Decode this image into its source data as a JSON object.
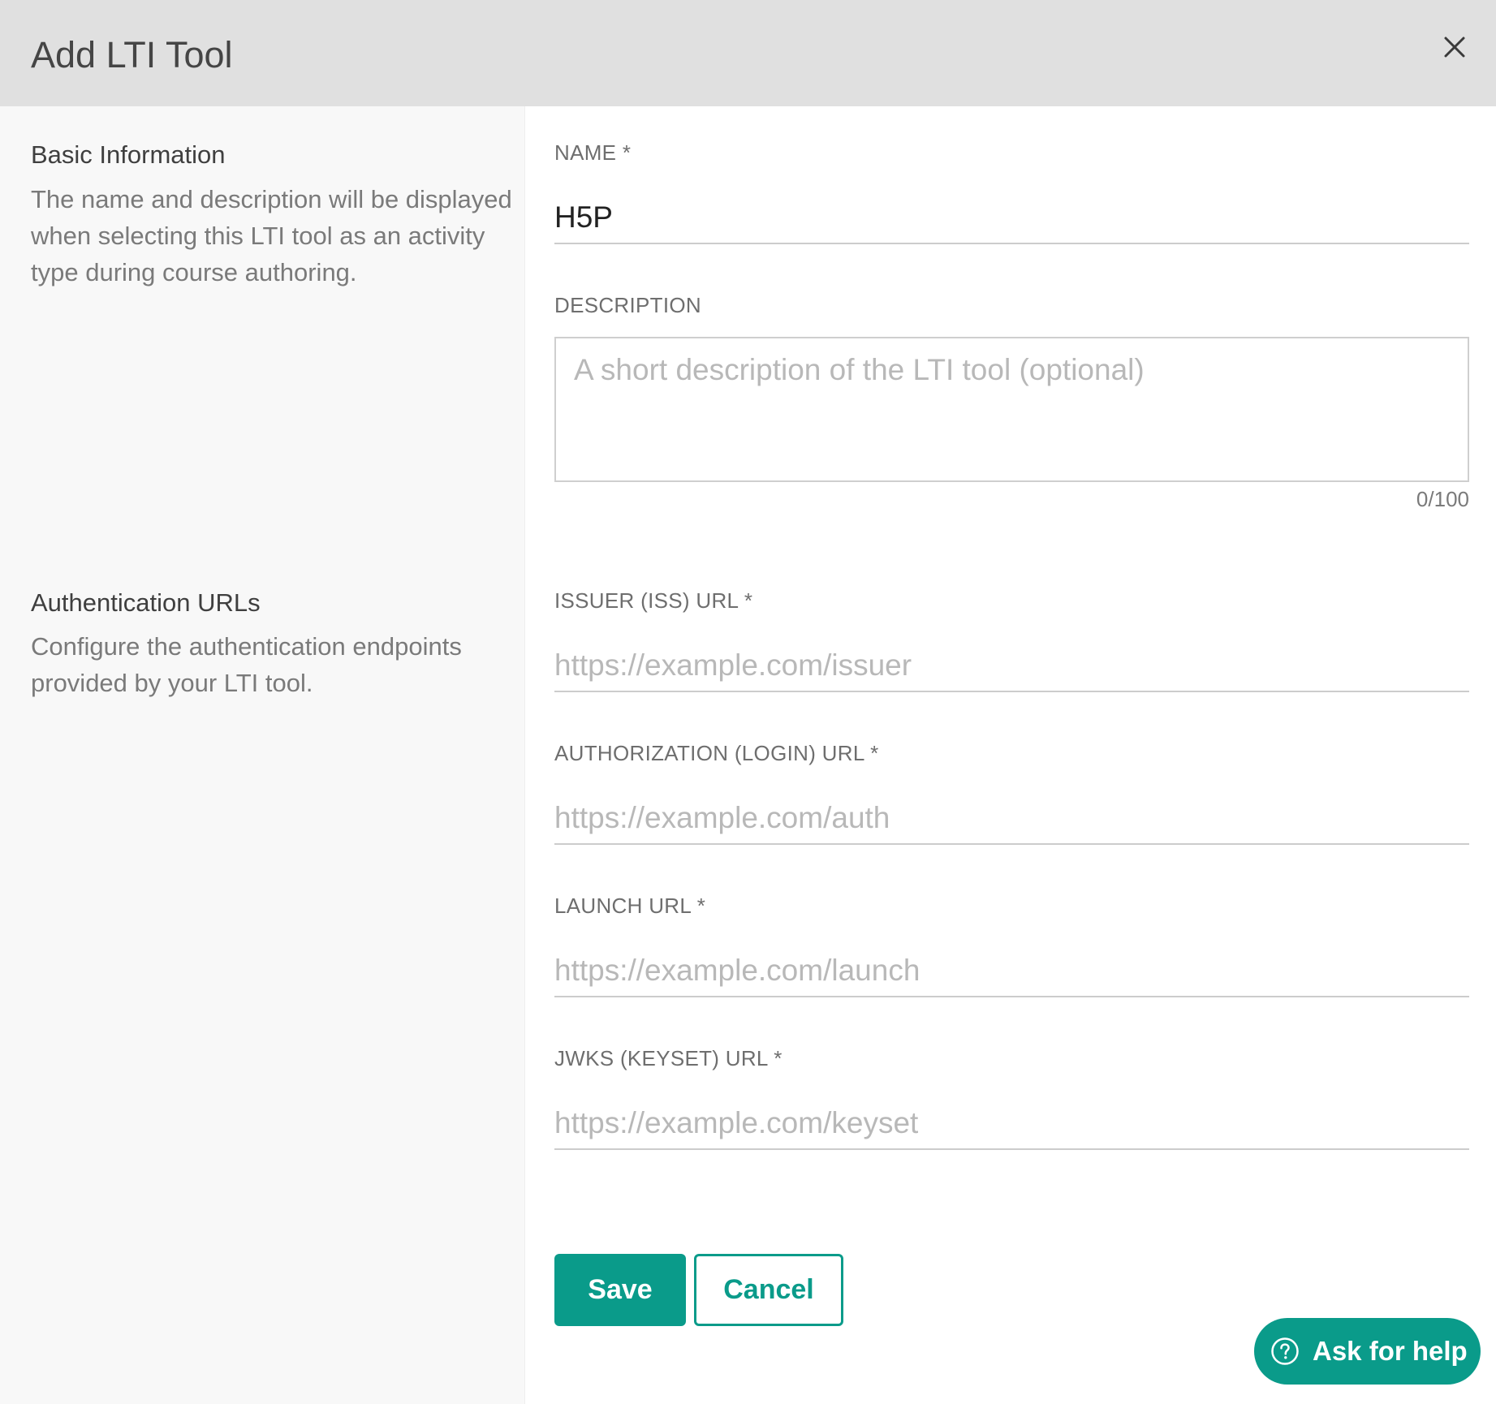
{
  "dialog": {
    "title": "Add LTI Tool",
    "close_icon": "close-icon"
  },
  "sections": {
    "basic": {
      "title": "Basic Information",
      "description": "The name and description will be displayed when selecting this LTI tool as an activity type during course authoring."
    },
    "auth": {
      "title": "Authentication URLs",
      "description": "Configure the authentication endpoints provided by your LTI tool."
    }
  },
  "fields": {
    "name": {
      "label": "NAME *",
      "value": "H5P"
    },
    "description": {
      "label": "DESCRIPTION",
      "placeholder": "A short description of the LTI tool (optional)",
      "value": "",
      "char_count": "0/100"
    },
    "issuer": {
      "label": "ISSUER (ISS) URL *",
      "placeholder": "https://example.com/issuer",
      "value": ""
    },
    "authorization": {
      "label": "AUTHORIZATION (LOGIN) URL *",
      "placeholder": "https://example.com/auth",
      "value": ""
    },
    "launch": {
      "label": "LAUNCH URL *",
      "placeholder": "https://example.com/launch",
      "value": ""
    },
    "jwks": {
      "label": "JWKS (KEYSET) URL *",
      "placeholder": "https://example.com/keyset",
      "value": ""
    }
  },
  "actions": {
    "save_label": "Save",
    "cancel_label": "Cancel"
  },
  "help": {
    "label": "Ask for help",
    "icon": "question-circle-icon"
  },
  "colors": {
    "accent": "#0a9b8a",
    "header_bg": "#e0e0e0",
    "left_pane_bg": "#f8f8f8"
  }
}
